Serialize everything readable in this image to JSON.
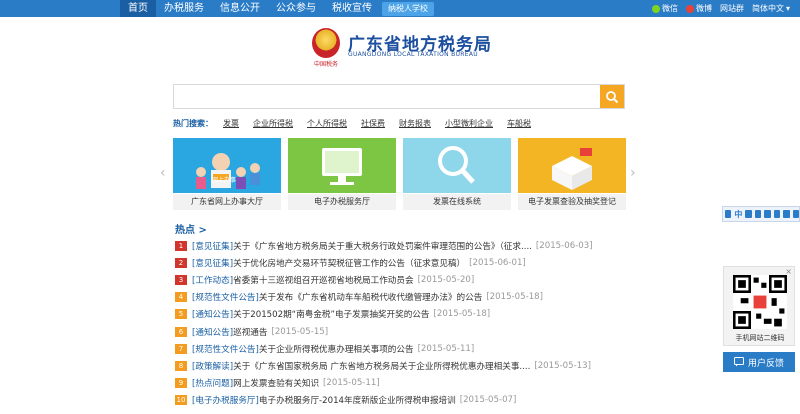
{
  "nav": {
    "items": [
      "首页",
      "办税服务",
      "信息公开",
      "公众参与",
      "税收宣传"
    ],
    "badge": "纳税人学校"
  },
  "top_right": {
    "wechat": "微信",
    "weibo": "微博",
    "site_group": "网站群",
    "language": "简体中文"
  },
  "logo": {
    "title": "广东省地方税务局",
    "subtitle": "GUANGDONG LOCAL TAXATION BUREAU",
    "seal_text": "中国税务"
  },
  "search": {
    "placeholder": "",
    "value": ""
  },
  "hot_search": {
    "label": "热门搜索：",
    "links": [
      "发票",
      "企业所得税",
      "个人所得税",
      "社保费",
      "财务报表",
      "小型微利企业",
      "车船税"
    ]
  },
  "tiles": [
    {
      "label": "广东省网上办事大厅",
      "color": "#2aa7e0",
      "sign": "网上办事"
    },
    {
      "label": "电子办税服务厅",
      "color": "#7cc644"
    },
    {
      "label": "发票在线系统",
      "color": "#8ed6ea"
    },
    {
      "label": "电子发票查验及抽奖登记",
      "color": "#f4b524"
    }
  ],
  "hot_news_title": "热点 >",
  "news": [
    {
      "num": "1",
      "cat": "[意见征集]",
      "text": "关于《广东省地方税务局关于重大税务行政处罚案件审理范围的公告》（征求....",
      "date": "[2015-06-03]"
    },
    {
      "num": "2",
      "cat": "[意见征集]",
      "text": "关于优化房地产交易环节契税征管工作的公告（征求意见稿）",
      "date": "[2015-06-01]"
    },
    {
      "num": "3",
      "cat": "[工作动态]",
      "text": "省委第十三巡视组召开巡视省地税局工作动员会",
      "date": "[2015-05-20]"
    },
    {
      "num": "4",
      "cat": "[规范性文件公告]",
      "text": "关于发布《广东省机动车车船税代收代缴管理办法》的公告",
      "date": "[2015-05-18]"
    },
    {
      "num": "5",
      "cat": "[通知公告]",
      "text": "关于201502期“南粤金税”电子发票抽奖开奖的公告",
      "date": "[2015-05-18]"
    },
    {
      "num": "6",
      "cat": "[通知公告]",
      "text": "巡视通告",
      "date": "[2015-05-15]"
    },
    {
      "num": "7",
      "cat": "[规范性文件公告]",
      "text": "关于企业所得税优惠办理相关事项的公告",
      "date": "[2015-05-11]"
    },
    {
      "num": "8",
      "cat": "[政策解读]",
      "text": "关于《广东省国家税务局 广东省地方税务局关于企业所得税优惠办理相关事....",
      "date": "[2015-05-13]"
    },
    {
      "num": "9",
      "cat": "[热点问题]",
      "text": "网上发票查验有关知识",
      "date": "[2015-05-11]"
    },
    {
      "num": "10",
      "cat": "[电子办税服务厅]",
      "text": "电子办税服务厅-2014年度新版企业所得税申报培训",
      "date": "[2015-05-07]"
    }
  ],
  "right_toolbar": {
    "lang": "中"
  },
  "qr": {
    "label": "手机网站二维码",
    "close": "×"
  },
  "feedback": {
    "label": "用户反馈"
  },
  "colors": {
    "nav_blue": "#2a7cc7",
    "accent_orange": "#f5a623",
    "link_blue": "#1a5fa3"
  }
}
